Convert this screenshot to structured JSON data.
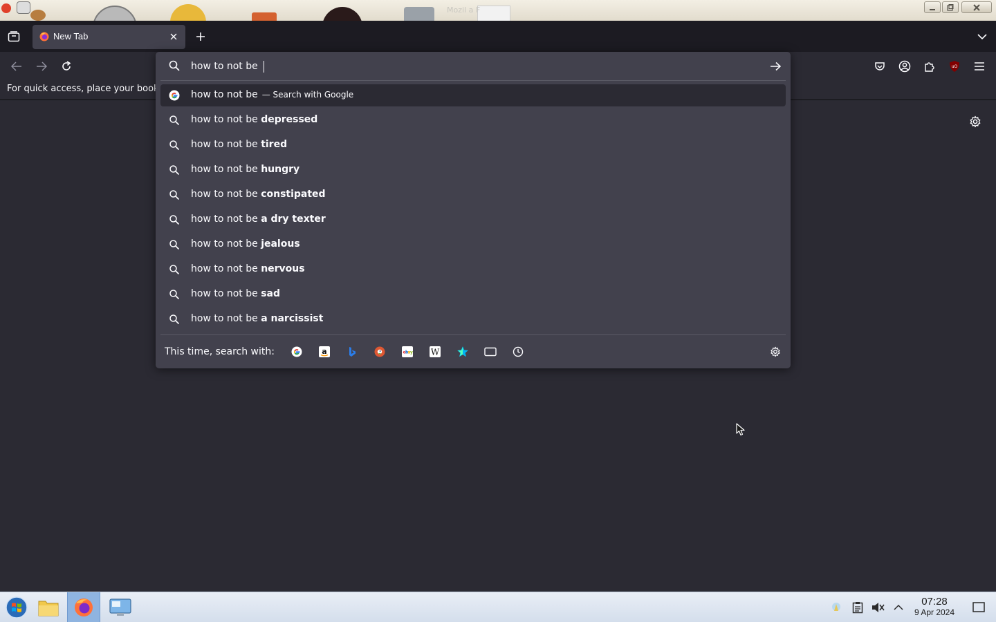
{
  "desktop": {
    "background_title": "Mozil a F"
  },
  "tabs": [
    {
      "title": "New Tab",
      "active": true
    }
  ],
  "bookmarks_bar": {
    "hint": "For quick access, place your bookmarks here on the bookmarks toolbar."
  },
  "urlbar": {
    "query": "how to not be ",
    "suggestions": [
      {
        "prefix": "how to not be",
        "bold": "",
        "action": "— Search with Google",
        "icon": "google-icon",
        "selected": true
      },
      {
        "prefix": "how to not be",
        "bold": "depressed",
        "icon": "search-icon"
      },
      {
        "prefix": "how to not be",
        "bold": "tired",
        "icon": "search-icon"
      },
      {
        "prefix": "how to not be",
        "bold": "hungry",
        "icon": "search-icon"
      },
      {
        "prefix": "how to not be",
        "bold": "constipated",
        "icon": "search-icon"
      },
      {
        "prefix": "how to not be",
        "bold": "a dry texter",
        "icon": "search-icon"
      },
      {
        "prefix": "how to not be",
        "bold": "jealous",
        "icon": "search-icon"
      },
      {
        "prefix": "how to not be",
        "bold": "nervous",
        "icon": "search-icon"
      },
      {
        "prefix": "how to not be",
        "bold": "sad",
        "icon": "search-icon"
      },
      {
        "prefix": "how to not be",
        "bold": "a narcissist",
        "icon": "search-icon"
      }
    ],
    "one_off_label": "This time, search with:",
    "one_off_engines": [
      "google-icon",
      "amazon-icon",
      "bing-icon",
      "duckduckgo-icon",
      "ebay-icon",
      "wikipedia-icon",
      "bookmarks-star-icon",
      "tabs-icon",
      "history-clock-icon"
    ]
  },
  "taskbar": {
    "time": "07:28",
    "date": "9 Apr 2024"
  },
  "colors": {
    "toolbar": "#2b2a33",
    "tabstrip": "#1c1b22",
    "popup": "#42414d",
    "text": "#fbfbfe"
  }
}
